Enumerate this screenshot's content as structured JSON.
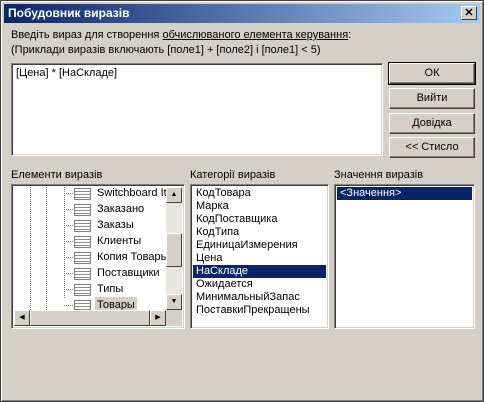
{
  "window": {
    "title": "Побудовник виразів",
    "close_glyph": "✕"
  },
  "instructions": {
    "line1_prefix": "Введіть вираз для створення ",
    "line1_link": "обчислюваного елемента керування",
    "line1_suffix": ":",
    "line2": "(Приклади виразів включають [поле1] + [поле2] і [поле1] < 5)"
  },
  "expression": {
    "value": "[Цена] * [НаСкладе]"
  },
  "buttons": {
    "ok": "ОК",
    "exit": "Вийти",
    "help": "Довідка",
    "less": "<< Стисло"
  },
  "panes": {
    "elements_label": "Елементи виразів",
    "categories_label": "Категорії виразів",
    "values_label": "Значення виразів"
  },
  "tree_items": [
    {
      "label": "Switchboard Ite"
    },
    {
      "label": "Заказано"
    },
    {
      "label": "Заказы"
    },
    {
      "label": "Клиенты"
    },
    {
      "label": "Копия Товары"
    },
    {
      "label": "Поставщики"
    },
    {
      "label": "Типы"
    },
    {
      "label": "Товары"
    }
  ],
  "tree_selected": "Товары",
  "categories": [
    "КодТовара",
    "Марка",
    "КодПоставщика",
    "КодТипа",
    "ЕдиницаИзмерения",
    "Цена",
    "НаСкладе",
    "Ожидается",
    "МинимальныйЗапас",
    "ПоставкиПрекращены"
  ],
  "categories_selected": "НаСкладе",
  "values": [
    "<Значення>"
  ],
  "values_selected": "<Значення>",
  "icons": {
    "tree_item_icon": "table-icon",
    "scroll_up": "▲",
    "scroll_down": "▼",
    "scroll_left": "◀",
    "scroll_right": "▶"
  }
}
